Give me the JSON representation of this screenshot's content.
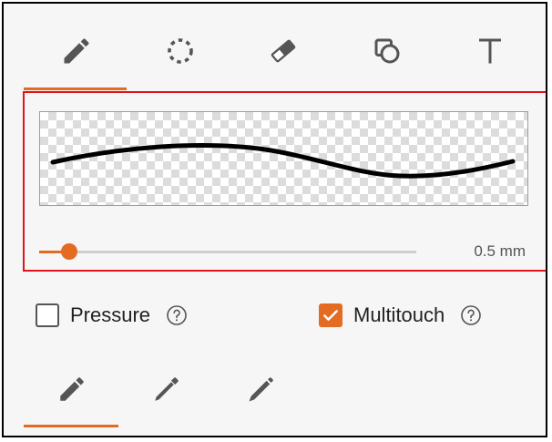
{
  "tool_tabs": [
    {
      "name": "pen",
      "icon": "pen-icon",
      "active": true
    },
    {
      "name": "lasso",
      "icon": "lasso-icon",
      "active": false
    },
    {
      "name": "eraser",
      "icon": "eraser-icon",
      "active": false
    },
    {
      "name": "shapes",
      "icon": "shapes-icon",
      "active": false
    },
    {
      "name": "text",
      "icon": "text-icon",
      "active": false
    }
  ],
  "stroke_preview": {
    "stroke_color": "#000000",
    "width_value": 0.5,
    "width_label": "0.5 mm",
    "slider_fraction": 0.08
  },
  "options": {
    "pressure": {
      "label": "Pressure",
      "checked": false
    },
    "multitouch": {
      "label": "Multitouch",
      "checked": true
    }
  },
  "pen_types": [
    {
      "name": "fountain-pen",
      "icon": "fountain-pen-icon",
      "active": true
    },
    {
      "name": "highlighter",
      "icon": "highlighter-icon",
      "active": false
    },
    {
      "name": "ballpoint",
      "icon": "ballpoint-pen-icon",
      "active": false
    }
  ],
  "colors": {
    "accent": "#e36b22",
    "highlight_border": "#e0141c",
    "icon": "#555555"
  }
}
